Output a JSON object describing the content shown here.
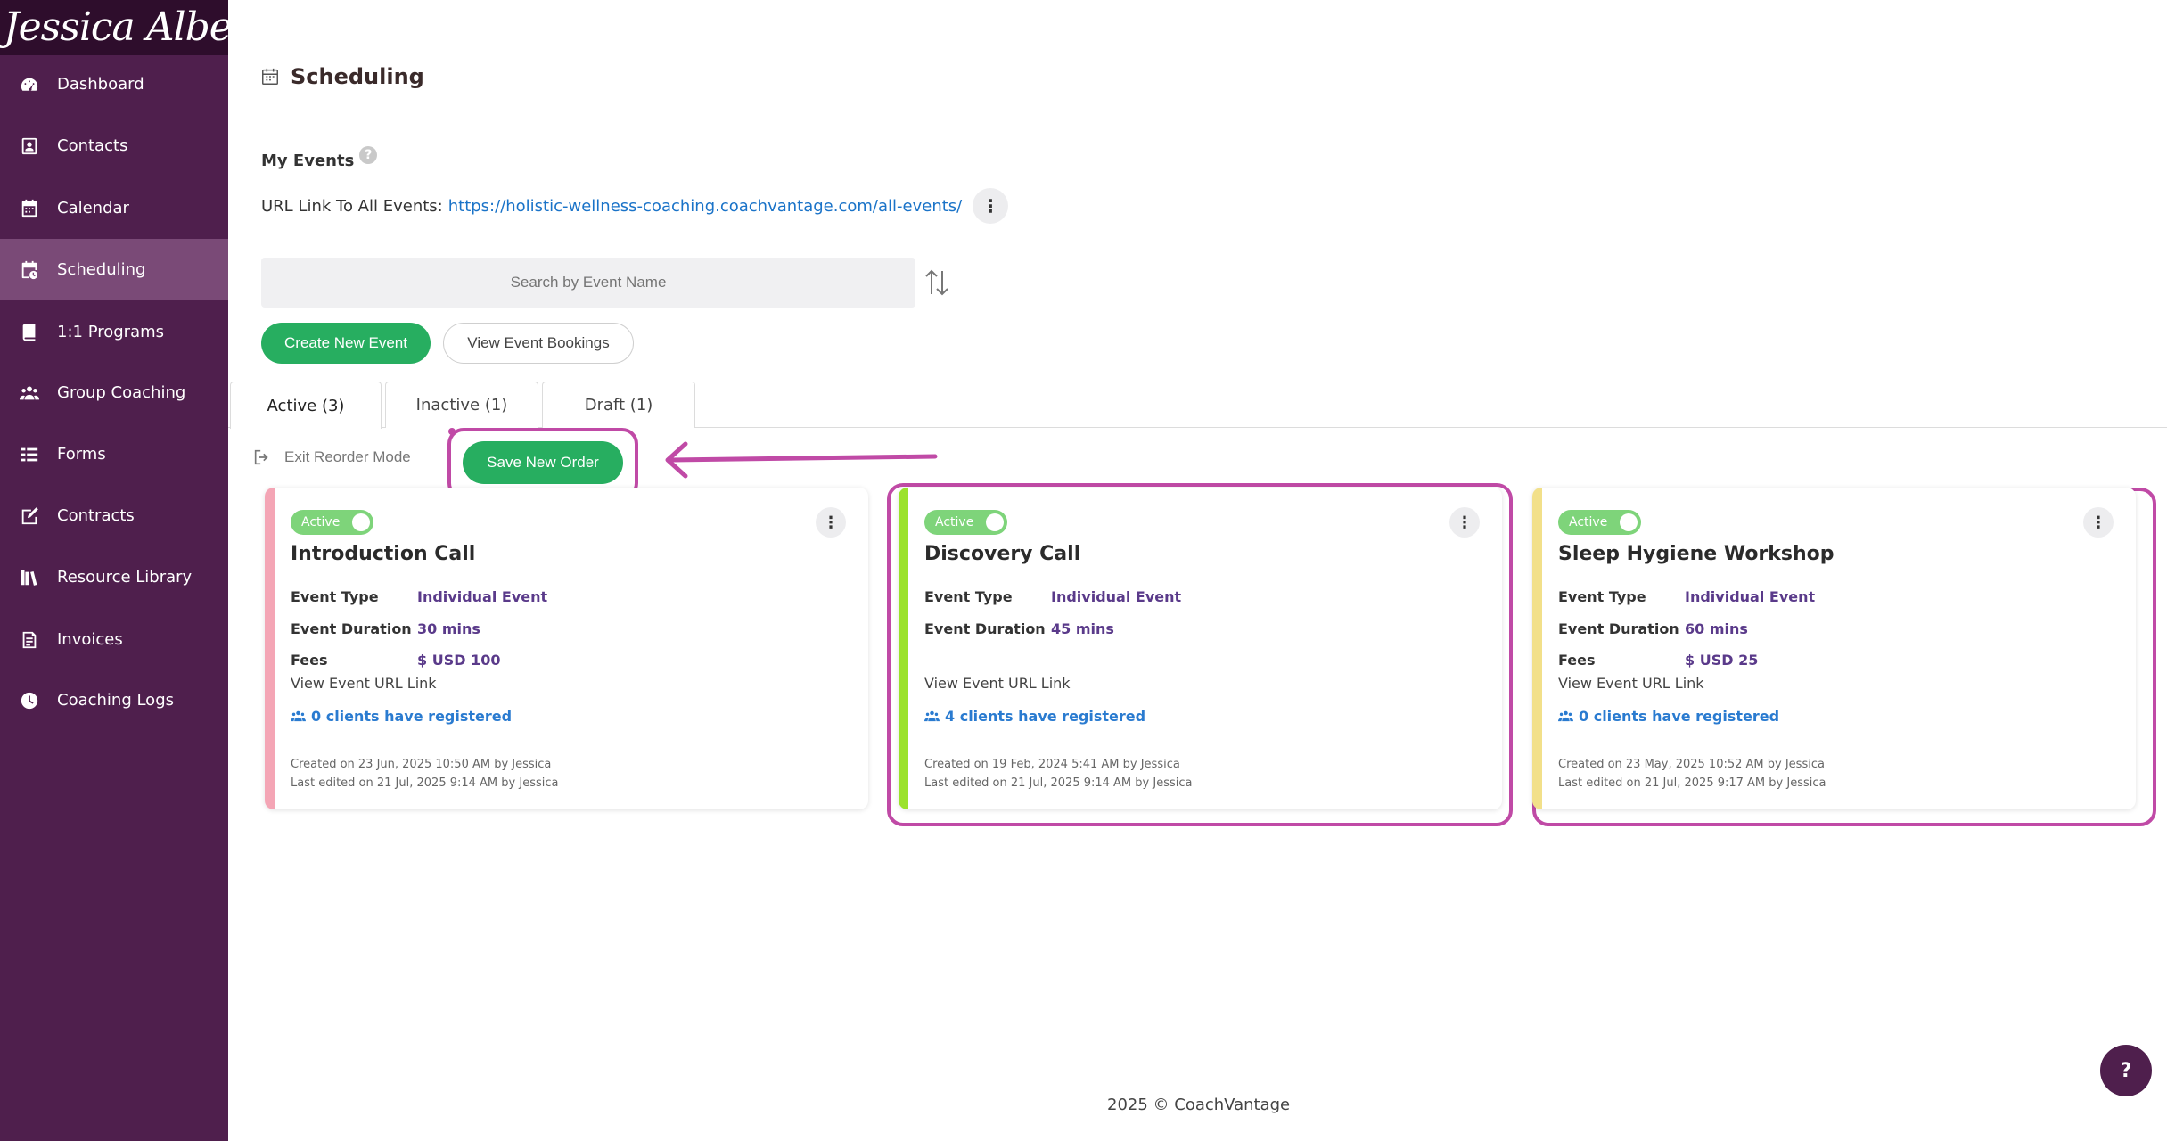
{
  "sidebar": {
    "logo_text": "Jessica Albert",
    "items": [
      {
        "label": "Dashboard",
        "icon": "dashboard-icon"
      },
      {
        "label": "Contacts",
        "icon": "contacts-icon"
      },
      {
        "label": "Calendar",
        "icon": "calendar-icon"
      },
      {
        "label": "Scheduling",
        "icon": "scheduling-icon",
        "active": true
      },
      {
        "label": "1:1 Programs",
        "icon": "book-icon"
      },
      {
        "label": "Group Coaching",
        "icon": "group-icon"
      },
      {
        "label": "Forms",
        "icon": "forms-icon"
      },
      {
        "label": "Contracts",
        "icon": "contract-icon"
      },
      {
        "label": "Resource Library",
        "icon": "library-icon"
      },
      {
        "label": "Invoices",
        "icon": "invoice-icon"
      },
      {
        "label": "Coaching Logs",
        "icon": "clock-icon"
      }
    ]
  },
  "header": {
    "title": "Scheduling"
  },
  "my_events": {
    "label": "My Events",
    "help": "?",
    "url_label": "URL Link To All Events:",
    "url": "https://holistic-wellness-coaching.coachvantage.com/all-events/",
    "more": "⋮"
  },
  "search": {
    "placeholder": "Search by Event Name"
  },
  "actions": {
    "create": "Create New Event",
    "bookings": "View Event Bookings"
  },
  "tabs": [
    {
      "label": "Active (3)",
      "active": true
    },
    {
      "label": "Inactive (1)"
    },
    {
      "label": "Draft (1)"
    }
  ],
  "reorder": {
    "exit_label": "Exit Reorder Mode",
    "save_label": "Save New Order"
  },
  "cards": [
    {
      "status": "Active",
      "title": "Introduction Call",
      "type_label": "Event Type",
      "type": "Individual Event",
      "duration_label": "Event Duration",
      "duration": "30 mins",
      "fees_label": "Fees",
      "fees": "$ USD 100",
      "link": "View Event URL Link",
      "clients": "0 clients have registered",
      "created": "Created on 23 Jun, 2025 10:50 AM by Jessica",
      "edited": "Last edited on 21 Jul, 2025 9:14 AM by Jessica",
      "color": "#f4a5b5",
      "more": "⋮"
    },
    {
      "status": "Active",
      "title": "Discovery Call",
      "type_label": "Event Type",
      "type": "Individual Event",
      "duration_label": "Event Duration",
      "duration": "45 mins",
      "link": "View Event URL Link",
      "clients": "4 clients have registered",
      "created": "Created on 19 Feb, 2024 5:41 AM by Jessica",
      "edited": "Last edited on 21 Jul, 2025 9:14 AM by Jessica",
      "color": "#9be22c",
      "more": "⋮"
    },
    {
      "status": "Active",
      "title": "Sleep Hygiene Workshop",
      "type_label": "Event Type",
      "type": "Individual Event",
      "duration_label": "Event Duration",
      "duration": "60 mins",
      "fees_label": "Fees",
      "fees": "$ USD 25",
      "link": "View Event URL Link",
      "clients": "0 clients have registered",
      "created": "Created on 23 May, 2025 10:52 AM by Jessica",
      "edited": "Last edited on 21 Jul, 2025 9:17 AM by Jessica",
      "color": "#f2e08a",
      "more": "⋮"
    }
  ],
  "footer": {
    "text": "2025 © CoachVantage"
  },
  "help_fab": "?",
  "colors": {
    "sidebar": "#4f1f4d",
    "accent_green": "#27ae60",
    "highlight": "#c04aa6",
    "link": "#1a73c8"
  }
}
